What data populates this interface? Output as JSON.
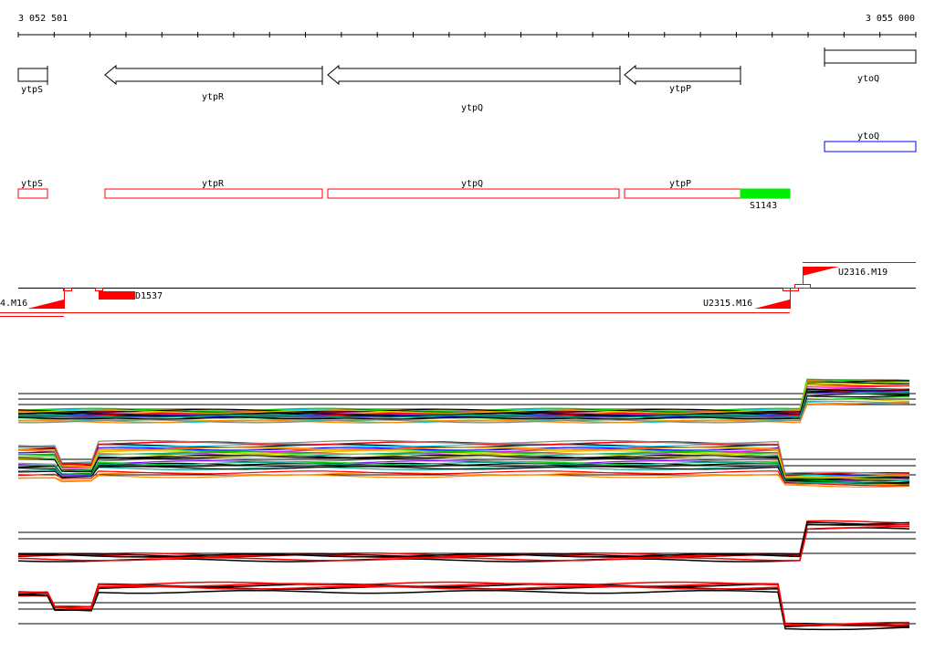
{
  "ruler": {
    "start_label": "3 052 501",
    "end_label": "3 055 000",
    "tick_count": 26
  },
  "annotated_genes": [
    {
      "name": "ytpS",
      "strand": "+"
    },
    {
      "name": "ytpR",
      "strand": "-"
    },
    {
      "name": "ytpQ",
      "strand": "-"
    },
    {
      "name": "ytpP",
      "strand": "-"
    },
    {
      "name": "ytoQ",
      "strand": "+"
    }
  ],
  "segments_forward": [
    {
      "name": "ytoQ"
    }
  ],
  "segments_reverse": [
    {
      "name": "ytpS"
    },
    {
      "name": "ytpR"
    },
    {
      "name": "ytpQ"
    },
    {
      "name": "ytpP"
    },
    {
      "name": "S1143"
    }
  ],
  "transcripts": [
    {
      "name": "4.M16"
    },
    {
      "name": "D1537"
    },
    {
      "name": "U2315.M16"
    },
    {
      "name": "U2316.M19"
    }
  ],
  "colors": {
    "forward": "#0000ff",
    "reverse": "#ff0000",
    "highlight": "#00ee00",
    "axis": "#000000"
  }
}
